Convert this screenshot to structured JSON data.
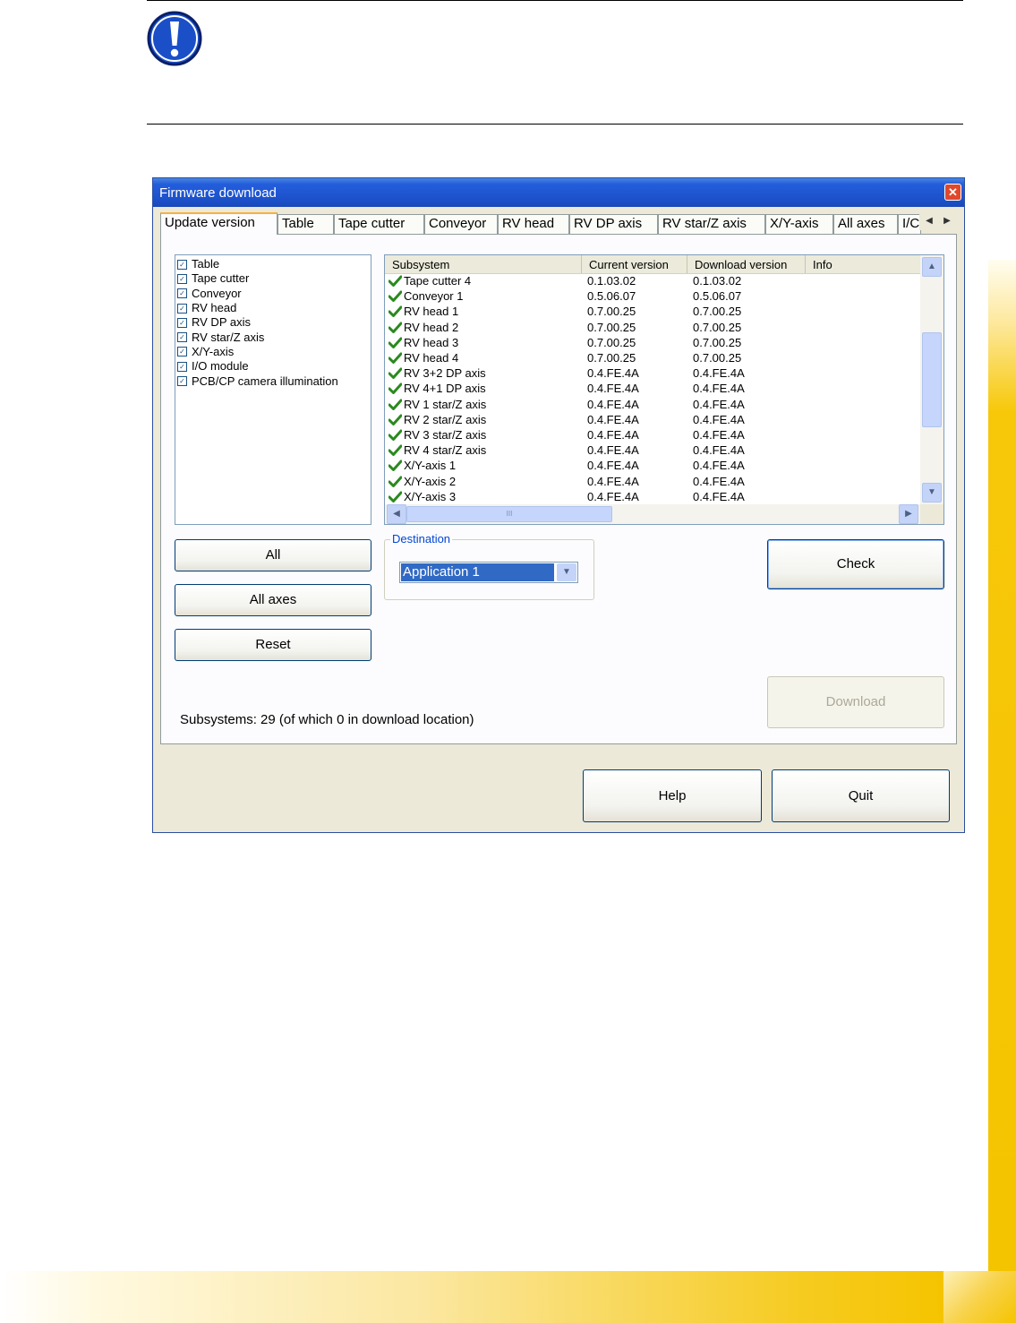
{
  "window": {
    "title": "Firmware download",
    "close_label": "✕"
  },
  "tabs": [
    {
      "label": "Update version"
    },
    {
      "label": "Table"
    },
    {
      "label": "Tape cutter"
    },
    {
      "label": "Conveyor"
    },
    {
      "label": "RV head"
    },
    {
      "label": "RV DP axis"
    },
    {
      "label": "RV star/Z axis"
    },
    {
      "label": "X/Y-axis"
    },
    {
      "label": "All axes"
    },
    {
      "label": "I/C"
    }
  ],
  "tab_scroll": {
    "left": "◀",
    "right": "▶"
  },
  "subsystem_list": [
    {
      "label": "Table",
      "checked": true
    },
    {
      "label": "Tape cutter",
      "checked": true
    },
    {
      "label": "Conveyor",
      "checked": true
    },
    {
      "label": "RV head",
      "checked": true
    },
    {
      "label": "RV DP axis",
      "checked": true
    },
    {
      "label": "RV star/Z axis",
      "checked": true
    },
    {
      "label": "X/Y-axis",
      "checked": true
    },
    {
      "label": "I/O module",
      "checked": true
    },
    {
      "label": "PCB/CP camera illumination",
      "checked": true
    }
  ],
  "check_mark": "✓",
  "grid": {
    "headers": [
      "Subsystem",
      "Current version",
      "Download version",
      "Info"
    ],
    "rows": [
      {
        "subsystem": "Tape cutter 4",
        "current": "0.1.03.02",
        "download": "0.1.03.02",
        "info": ""
      },
      {
        "subsystem": "Conveyor 1",
        "current": "0.5.06.07",
        "download": "0.5.06.07",
        "info": ""
      },
      {
        "subsystem": "RV head 1",
        "current": "0.7.00.25",
        "download": "0.7.00.25",
        "info": ""
      },
      {
        "subsystem": "RV head 2",
        "current": "0.7.00.25",
        "download": "0.7.00.25",
        "info": ""
      },
      {
        "subsystem": "RV head 3",
        "current": "0.7.00.25",
        "download": "0.7.00.25",
        "info": ""
      },
      {
        "subsystem": "RV head 4",
        "current": "0.7.00.25",
        "download": "0.7.00.25",
        "info": ""
      },
      {
        "subsystem": "RV 3+2 DP axis",
        "current": "0.4.FE.4A",
        "download": "0.4.FE.4A",
        "info": ""
      },
      {
        "subsystem": "RV 4+1 DP axis",
        "current": "0.4.FE.4A",
        "download": "0.4.FE.4A",
        "info": ""
      },
      {
        "subsystem": "RV 1 star/Z axis",
        "current": "0.4.FE.4A",
        "download": "0.4.FE.4A",
        "info": ""
      },
      {
        "subsystem": "RV 2 star/Z axis",
        "current": "0.4.FE.4A",
        "download": "0.4.FE.4A",
        "info": ""
      },
      {
        "subsystem": "RV 3 star/Z axis",
        "current": "0.4.FE.4A",
        "download": "0.4.FE.4A",
        "info": ""
      },
      {
        "subsystem": "RV 4 star/Z axis",
        "current": "0.4.FE.4A",
        "download": "0.4.FE.4A",
        "info": ""
      },
      {
        "subsystem": "X/Y-axis 1",
        "current": "0.4.FE.4A",
        "download": "0.4.FE.4A",
        "info": ""
      },
      {
        "subsystem": "X/Y-axis 2",
        "current": "0.4.FE.4A",
        "download": "0.4.FE.4A",
        "info": ""
      },
      {
        "subsystem": "X/Y-axis 3",
        "current": "0.4.FE.4A",
        "download": "0.4.FE.4A",
        "info": ""
      }
    ],
    "scroll_up": "▲",
    "scroll_down": "▼",
    "scroll_left": "◀",
    "scroll_right": "▶",
    "hthumb_grip": "III"
  },
  "buttons": {
    "all": "All",
    "all_axes": "All axes",
    "reset": "Reset",
    "check": "Check",
    "download": "Download",
    "help": "Help",
    "quit": "Quit"
  },
  "destination": {
    "label": "Destination",
    "selected": "Application 1",
    "arrow": "▼"
  },
  "status": "Subsystems: 29 (of which 0 in download location)",
  "colors": {
    "titlebar": "#245edc",
    "selection": "#316ac5",
    "check_green": "#2a8a1e",
    "accent_yellow": "#f5c400",
    "warning_blue": "#1b4fc8"
  },
  "icons": {
    "warning": "exclamation-circle-icon",
    "row_status": "green-checkmark-icon",
    "close": "close-icon"
  }
}
